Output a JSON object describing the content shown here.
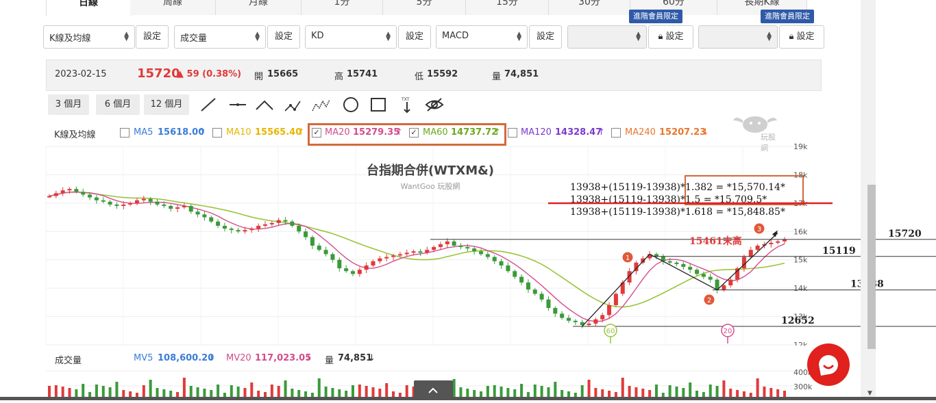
{
  "tabs": [
    "日線",
    "周線",
    "月線",
    "1分",
    "5分",
    "15分",
    "30分",
    "60分",
    "長期K線"
  ],
  "selectors": [
    {
      "label": "K線及均線",
      "button": "設定"
    },
    {
      "label": "成交量",
      "button": "設定"
    },
    {
      "label": "KD",
      "button": "設定"
    },
    {
      "label": "MACD",
      "button": "設定"
    },
    {
      "label": "",
      "button": "設定",
      "ribbon": "進階會員限定"
    },
    {
      "label": "",
      "button": "設定",
      "ribbon": "進階會員限定"
    }
  ],
  "quote": {
    "date": "2023-02-15",
    "price": "15720",
    "change": "▲ 59 (0.38%)",
    "open_label": "開",
    "open": "15665",
    "high_label": "高",
    "high": "15741",
    "low_label": "低",
    "low": "15592",
    "vol_label": "量",
    "vol": "74,851"
  },
  "ranges": [
    "3 個月",
    "6 個月",
    "12 個月"
  ],
  "ma_label": "K線及均線",
  "ma": [
    {
      "name": "MA5",
      "value": "15618.00",
      "arrow": "↑",
      "checked": false,
      "color": "#3b7dd8"
    },
    {
      "name": "MA10",
      "value": "15565.40",
      "arrow": "↑",
      "checked": false,
      "color": "#e8b400"
    },
    {
      "name": "MA20",
      "value": "15279.35",
      "arrow": "↑",
      "checked": true,
      "color": "#d24c8c"
    },
    {
      "name": "MA60",
      "value": "14737.72",
      "arrow": "↑",
      "checked": true,
      "color": "#6aa820"
    },
    {
      "name": "MA120",
      "value": "14328.47",
      "arrow": "↑",
      "checked": false,
      "color": "#7a3bd0"
    },
    {
      "name": "MA240",
      "value": "15207.23",
      "arrow": "↓",
      "checked": false,
      "color": "#e8772e"
    }
  ],
  "watermark": "玩股網",
  "vol": {
    "label": "成交量",
    "mv5_name": "MV5",
    "mv5": "108,600.20",
    "mv5_arrow": "↓",
    "mv20_name": "MV20",
    "mv20": "117,023.05",
    "mv20_arrow": "↓",
    "vol_name": "量",
    "vol": "74,851",
    "vol_arrow": "↓"
  },
  "colors": {
    "up": "#e03a3a",
    "down": "#3a9a3a",
    "ma20": "#d24c8c",
    "ma60": "#9ac43a",
    "highlight": "#d4693a",
    "accent_red": "#e02020"
  },
  "chart_data": {
    "type": "candlestick",
    "title": "台指期合併(WTXM&)",
    "subtitle": "WantGoo 玩股網",
    "y_ticks": [
      "19k",
      "18k",
      "17k",
      "16k",
      "15k",
      "14k",
      "13k",
      "12k"
    ],
    "vol_ticks": [
      "400k",
      "300k"
    ],
    "ylim": [
      12000,
      19000
    ],
    "closes": [
      17250,
      17350,
      17450,
      17500,
      17400,
      17300,
      17200,
      17100,
      17050,
      16950,
      16900,
      16950,
      17000,
      17100,
      17150,
      17050,
      16950,
      16900,
      16800,
      16850,
      16900,
      16700,
      16600,
      16500,
      16350,
      16200,
      16100,
      16050,
      16000,
      16050,
      16100,
      16200,
      16250,
      16300,
      16400,
      16350,
      16200,
      16000,
      15800,
      15500,
      15350,
      15200,
      15000,
      14700,
      14600,
      14500,
      14650,
      14800,
      14950,
      15050,
      15100,
      15150,
      15200,
      15250,
      15300,
      15250,
      15350,
      15450,
      15550,
      15650,
      15500,
      15450,
      15400,
      15300,
      15200,
      15100,
      14950,
      14800,
      14600,
      14400,
      14200,
      13950,
      13800,
      13600,
      13300,
      13100,
      12950,
      12850,
      12800,
      12700,
      12750,
      12900,
      13050,
      13400,
      13800,
      14200,
      14600,
      14900,
      15050,
      15200,
      15119,
      14950,
      14900,
      14850,
      14750,
      14650,
      14500,
      14400,
      14300,
      13938,
      14100,
      14300,
      14700,
      15100,
      15350,
      15500,
      15550,
      15600,
      15650,
      15720
    ],
    "annotations": {
      "calc_lines": [
        "13938+(15119-13938)*1.382 = *15,570.14*",
        "13938+(15119-13938)*1.5 = *15,709.5*",
        "13938+(15119-13938)*1.618 = *15,848.85*"
      ],
      "levels": [
        {
          "label": "15720",
          "value": 15720
        },
        {
          "label": "15119",
          "value": 15119
        },
        {
          "label": "13938",
          "value": 13938
        },
        {
          "label": "12652",
          "value": 12652
        }
      ],
      "recent_high": "15461末高",
      "wave_points": [
        "1",
        "2",
        "3"
      ],
      "ma_markers": [
        "60",
        "20"
      ]
    }
  }
}
